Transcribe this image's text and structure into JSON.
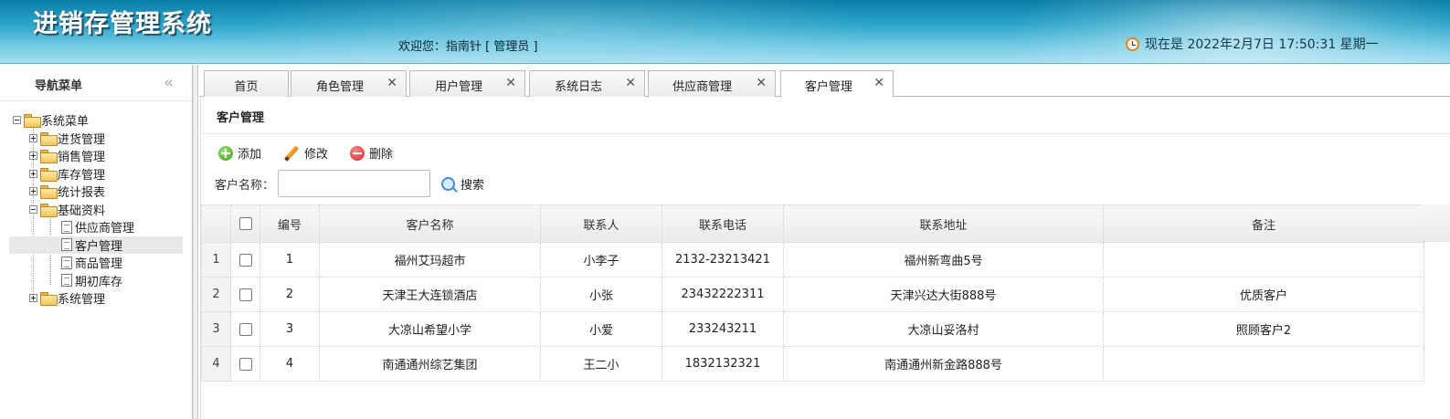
{
  "header": {
    "app_title": "进销存管理系统",
    "welcome": "欢迎您：指南针 [ 管理员 ]",
    "clock": "现在是 2022年2月7日 17:50:31 星期一"
  },
  "sidebar": {
    "title": "导航菜单",
    "collapse_icon": "«",
    "tree": {
      "root": "系统菜单",
      "items": [
        "进货管理",
        "销售管理",
        "库存管理",
        "统计报表",
        "基础资料"
      ],
      "sub_items": [
        "供应商管理",
        "客户管理",
        "商品管理",
        "期初库存"
      ],
      "last": "系统管理"
    }
  },
  "tabs": [
    {
      "label": "首页"
    },
    {
      "label": "角色管理"
    },
    {
      "label": "用户管理"
    },
    {
      "label": "系统日志"
    },
    {
      "label": "供应商管理"
    },
    {
      "label": "客户管理"
    }
  ],
  "close_glyph": "✕",
  "panel": {
    "title": "客户管理",
    "toolbar": {
      "add": "添加",
      "edit": "修改",
      "delete": "删除"
    },
    "search": {
      "label": "客户名称：",
      "value": "",
      "placeholder": "",
      "button": "搜索"
    }
  },
  "grid": {
    "columns": [
      "编号",
      "客户名称",
      "联系人",
      "联系电话",
      "联系地址",
      "备注"
    ],
    "rows": [
      {
        "rn": "1",
        "id": "1",
        "name": "福州艾玛超市",
        "contact": "小李子",
        "phone": "2132-23213421",
        "address": "福州新弯曲5号",
        "remark": ""
      },
      {
        "rn": "2",
        "id": "2",
        "name": "天津王大连锁酒店",
        "contact": "小张",
        "phone": "23432222311",
        "address": "天津兴达大街888号",
        "remark": "优质客户"
      },
      {
        "rn": "3",
        "id": "3",
        "name": "大凉山希望小学",
        "contact": "小爱",
        "phone": "233243211",
        "address": "大凉山妥洛村",
        "remark": "照顾客户2"
      },
      {
        "rn": "4",
        "id": "4",
        "name": "南通通州综艺集团",
        "contact": "王二小",
        "phone": "1832132321",
        "address": "南通通州新金路888号",
        "remark": ""
      }
    ]
  },
  "colors": {
    "header_top": "#0a7ea8",
    "header_bottom": "#a8dff0",
    "selected_node": "#e8e8e8"
  }
}
